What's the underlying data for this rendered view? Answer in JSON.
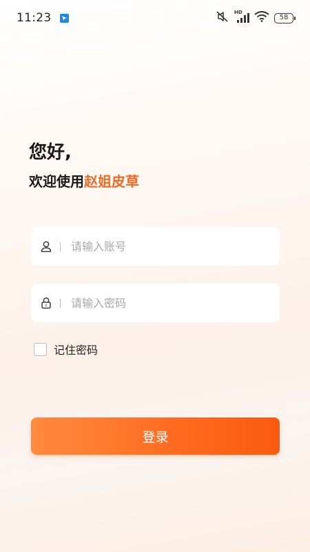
{
  "status_bar": {
    "time": "11:23",
    "battery": "58",
    "network_label": "HD",
    "icons": [
      "app-notification-icon",
      "mute-icon",
      "signal-icon",
      "wifi-icon",
      "battery-icon"
    ]
  },
  "greeting": {
    "hello": "您好,",
    "welcome_prefix": "欢迎使用",
    "brand_name": "赵姐皮草"
  },
  "form": {
    "username_placeholder": "请输入账号",
    "password_placeholder": "请输入密码",
    "username_value": "",
    "password_value": "",
    "remember_label": "记住密码",
    "remember_checked": false
  },
  "login_button": {
    "label": "登录"
  },
  "colors": {
    "brand": "#f26a21",
    "button_start": "#ff8a3d",
    "button_end": "#fa5a0f"
  }
}
